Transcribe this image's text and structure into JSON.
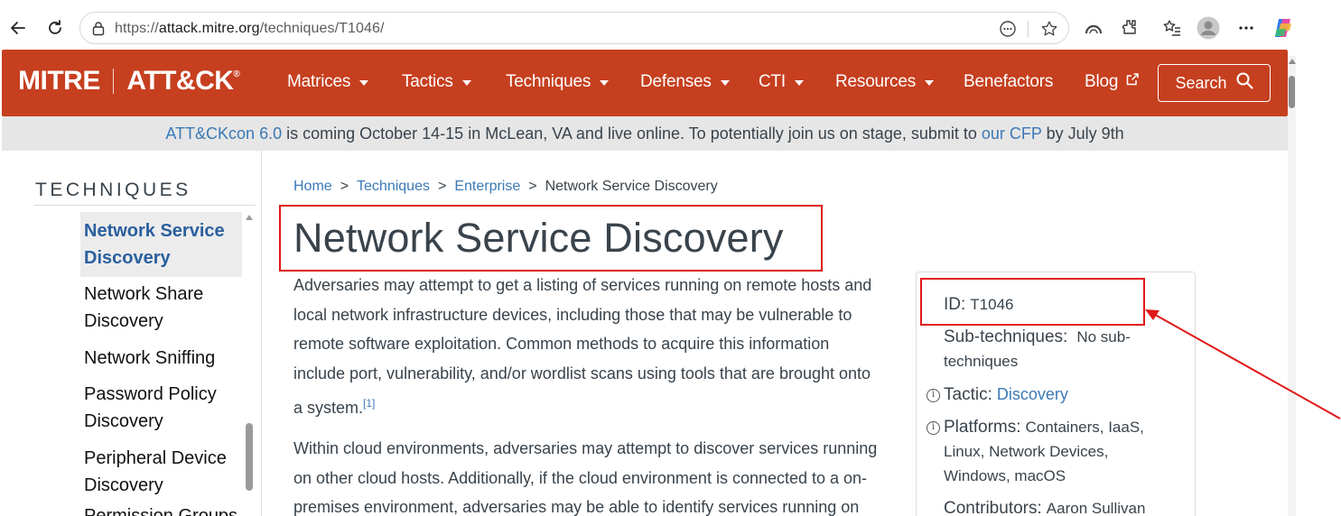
{
  "browser": {
    "url_scheme": "https://",
    "url_host": "attack.mitre.org",
    "url_path": "/techniques/T1046/"
  },
  "header": {
    "logo_left": "MITRE",
    "logo_right": "ATT&CK",
    "logo_reg": "®",
    "menu": [
      {
        "label": "Matrices",
        "dropdown": true
      },
      {
        "label": "Tactics",
        "dropdown": true
      },
      {
        "label": "Techniques",
        "dropdown": true
      },
      {
        "label": "Defenses",
        "dropdown": true
      },
      {
        "label": "CTI",
        "dropdown": true
      },
      {
        "label": "Resources",
        "dropdown": true
      },
      {
        "label": "Benefactors",
        "dropdown": false
      },
      {
        "label": "Blog",
        "dropdown": false
      }
    ],
    "search_label": "Search",
    "bg_color": "#c63f1f"
  },
  "banner": {
    "link1": "ATT&CKcon 6.0",
    "text1": " is coming October 14-15 in McLean, VA and live online. To potentially join us on stage, submit to ",
    "link2": "our CFP",
    "text2": " by July 9th"
  },
  "sidebar": {
    "heading": "TECHNIQUES",
    "items": [
      {
        "line1": "Network Service",
        "line2": "Discovery",
        "active": true
      },
      {
        "line1": "Network Share",
        "line2": "Discovery",
        "active": false
      },
      {
        "line1": "Network Sniffing",
        "line2": "",
        "active": false
      },
      {
        "line1": "Password Policy",
        "line2": "Discovery",
        "active": false
      },
      {
        "line1": "Peripheral Device",
        "line2": "Discovery",
        "active": false
      },
      {
        "line1": "Permission Groups",
        "line2": "",
        "active": false
      }
    ]
  },
  "breadcrumb": {
    "home": "Home",
    "techniques": "Techniques",
    "enterprise": "Enterprise",
    "current": "Network Service Discovery",
    "separator": ">"
  },
  "main": {
    "title": "Network Service Discovery",
    "para1_lines": [
      "Adversaries may attempt to get a listing of services running on remote hosts and",
      "local network infrastructure devices, including those that may be vulnerable to",
      "remote software exploitation. Common methods to acquire this information",
      "include port, vulnerability, and/or wordlist scans using tools that are brought onto",
      "a system."
    ],
    "para1_cite": "[1]",
    "para2_lines": [
      "Within cloud environments, adversaries may attempt to discover services running",
      "on other cloud hosts. Additionally, if the cloud environment is connected to a on-",
      "premises environment, adversaries may be able to identify services running on"
    ]
  },
  "card": {
    "id_label": "ID:",
    "id_value": "T1046",
    "subtech_label": "Sub-techniques:",
    "subtech_value_1": "No sub-",
    "subtech_value_2": "techniques",
    "tactic_label": "Tactic:",
    "tactic_value": "Discovery",
    "platforms_label": "Platforms:",
    "platforms_line1": "Containers, IaaS,",
    "platforms_line2": "Linux, Network Devices,",
    "platforms_line3": "Windows, macOS",
    "contributors_label": "Contributors:",
    "contributors_value": "Aaron Sullivan"
  },
  "annotations": {
    "highlight_color": "#e01818"
  }
}
